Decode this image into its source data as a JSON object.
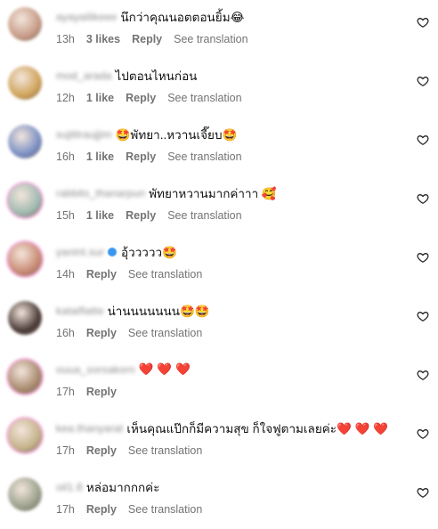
{
  "comments": [
    {
      "username": "ayayailikeee",
      "verified": false,
      "text": "นึกว่าคุณนอตตอนยิ้ม😂",
      "time": "13h",
      "likes": "3 likes",
      "reply": "Reply",
      "translation": "See translation",
      "avatar_color": "#c79a86"
    },
    {
      "username": "mod_arada",
      "verified": false,
      "text": "ไปตอนไหนก่อน",
      "time": "12h",
      "likes": "1 like",
      "reply": "Reply",
      "translation": "See translation",
      "avatar_color": "#d0a35a"
    },
    {
      "username": "sujittraujjim",
      "verified": false,
      "text": "🤩พัทยา..หวานเจี๊ยบ🤩",
      "time": "16h",
      "likes": "1 like",
      "reply": "Reply",
      "translation": "See translation",
      "avatar_color": "#7a8fc4"
    },
    {
      "username": "rabbits_thanarpun",
      "verified": false,
      "text": "พัทยาหวานมากค่าาา 🥰",
      "time": "15h",
      "likes": "1 like",
      "reply": "Reply",
      "translation": "See translation",
      "avatar_color": "#9fb9b0"
    },
    {
      "username": "yanint.sur",
      "verified": true,
      "text": "อุ้ววววว🤩",
      "time": "14h",
      "likes": "",
      "reply": "Reply",
      "translation": "See translation",
      "avatar_color": "#c98a74"
    },
    {
      "username": "kataiflatte",
      "verified": false,
      "text": "น่านนนนนนน🤩🤩",
      "time": "16h",
      "likes": "",
      "reply": "Reply",
      "translation": "See translation",
      "avatar_color": "#4a3a36"
    },
    {
      "username": "ouua_sorsakorn",
      "verified": false,
      "text": "❤️ ❤️ ❤️",
      "time": "17h",
      "likes": "",
      "reply": "Reply",
      "translation": "",
      "avatar_color": "#a88a6e"
    },
    {
      "username": "kea.thanyarat",
      "verified": false,
      "text": "เห็นคุณแป๊กก็มีความสุข ก็ใจฟูตามเลยค่ะ❤️ ❤️ ❤️",
      "time": "17h",
      "likes": "",
      "reply": "Reply",
      "translation": "See translation",
      "avatar_color": "#c4b28a"
    },
    {
      "username": "oil1.8",
      "verified": false,
      "text": "หล่อมากกกค่ะ",
      "time": "17h",
      "likes": "",
      "reply": "Reply",
      "translation": "See translation",
      "avatar_color": "#9aa08c"
    }
  ],
  "heart_icon": "heart-outline-icon"
}
